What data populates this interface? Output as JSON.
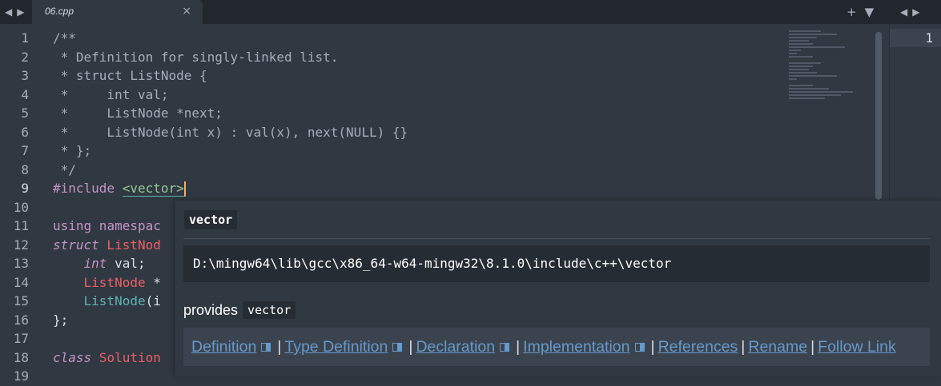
{
  "tabbar": {
    "left_arrows": [
      "◀",
      "▶"
    ],
    "tab": {
      "title": "06.cpp",
      "close": "×"
    },
    "actions": [
      "+",
      "▼"
    ],
    "right_arrows": [
      "◀",
      "▶"
    ]
  },
  "gutter": [
    "1",
    "2",
    "3",
    "4",
    "5",
    "6",
    "7",
    "8",
    "9",
    "10",
    "11",
    "12",
    "13",
    "14",
    "15",
    "16",
    "17",
    "18",
    "19"
  ],
  "active_line": "9",
  "code": {
    "l1": "/**",
    "l2": " * Definition for singly-linked list.",
    "l3": " * struct ListNode {",
    "l4": " *     int val;",
    "l5": " *     ListNode *next;",
    "l6": " *     ListNode(int x) : val(x), next(NULL) {}",
    "l7": " * };",
    "l8": " */",
    "l9_kw": "#include",
    "l9_target": "<vector>",
    "l11_kw": "using",
    "l11_rest": " namespac",
    "l12_kw": "struct",
    "l12_type": " ListNod",
    "l13_kw": "int",
    "l13_rest": " val;",
    "l14_type": "ListNode",
    "l14_rest": " *",
    "l15_type": "ListNode",
    "l15_rest": "(i",
    "l16": "};",
    "l18_kw": "class",
    "l18_type": " Solution"
  },
  "right_pane": {
    "line_number": "1"
  },
  "popup": {
    "title": "vector",
    "path": "D:\\mingw64\\lib\\gcc\\x86_64-w64-mingw32\\8.1.0\\include\\c++\\vector",
    "provides_label": "provides",
    "provides_value": "vector",
    "links": {
      "definition": "Definition",
      "type_definition": "Type Definition",
      "declaration": "Declaration",
      "implementation": "Implementation",
      "references": "References",
      "rename": "Rename",
      "follow_link": "Follow Link"
    }
  },
  "colors": {
    "bg": "#303841",
    "accent": "#6699cc",
    "cursor": "#f9ae58"
  }
}
